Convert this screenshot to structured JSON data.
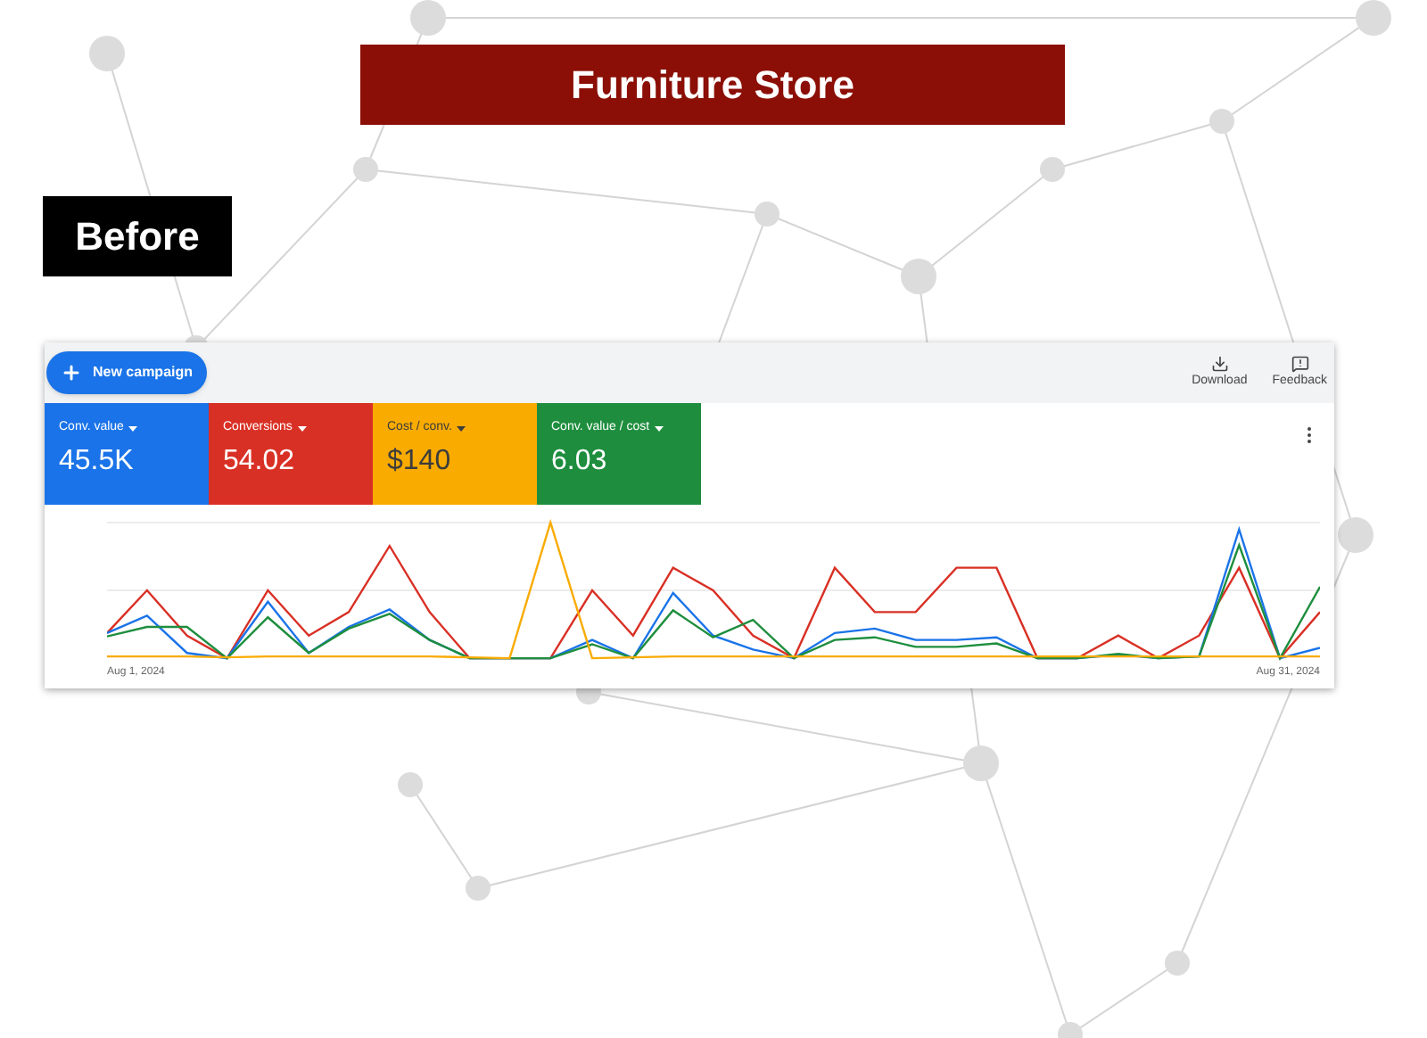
{
  "banner": {
    "title": "Furniture Store"
  },
  "badge": {
    "label": "Before"
  },
  "toolbar": {
    "new_campaign": "New campaign",
    "actions": [
      {
        "kind": "download",
        "label": "Download"
      },
      {
        "kind": "feedback",
        "label": "Feedback"
      }
    ]
  },
  "metrics": [
    {
      "label": "Conv. value",
      "value": "45.5K",
      "color": "#1a73e8"
    },
    {
      "label": "Conversions",
      "value": "54.02",
      "color": "#d93025"
    },
    {
      "label": "Cost / conv.",
      "value": "$140",
      "color": "#f9ab00"
    },
    {
      "label": "Conv. value / cost",
      "value": "6.03",
      "color": "#1e8e3e"
    }
  ],
  "chart": {
    "start_label": "Aug 1, 2024",
    "end_label": "Aug 31, 2024"
  }
}
